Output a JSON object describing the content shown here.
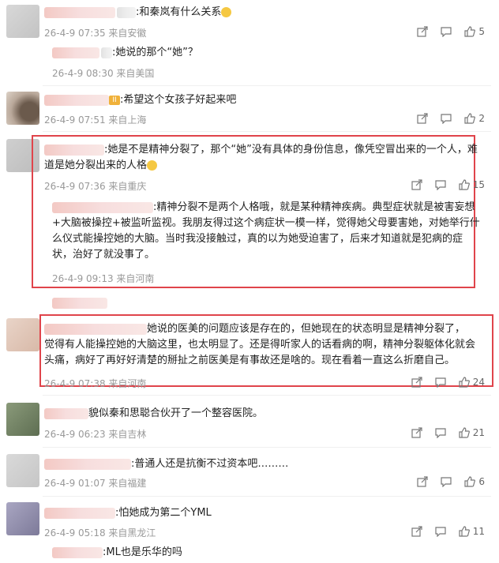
{
  "comments": [
    {
      "text": ":和秦岚有什么关系",
      "meta": "26-4-9 07:35 来自安徽",
      "likes": "5"
    },
    {
      "reply_text": ":她说的那个“她”？",
      "reply_meta": "26-4-9 08:30 来自美国"
    },
    {
      "text": ":希望这个女孩子好起来吧",
      "meta": "26-4-9 07:51 来自上海",
      "likes": "2"
    },
    {
      "text_line1": ":她是不是精神分裂了，那个“她”没有具体的身份信息，像凭空冒出来的一个人，难",
      "text_line2": "道是她分裂出来的人格",
      "meta": "26-4-9 07:36 来自重庆",
      "likes": "15"
    },
    {
      "reply_line1": ":精神分裂不是两个人格哦，就是某种精神疾病。典型症状就是被害妄想",
      "reply_line2": "+大脑被操控+被监听监视。我朋友得过这个病症状一模一样，觉得她父母要害她，对她举行什",
      "reply_line3": "么仪式能操控她的大脑。当时我没接触过，真的以为她受迫害了，后来才知道就是犯病的症",
      "reply_line4": "状，治好了就没事了。",
      "reply_meta": "26-4-9 09:13 来自河南"
    },
    {
      "line1": "她说的医美的问题应该是存在的，但她现在的状态明显是精神分裂了，",
      "line2": "觉得有人能操控她的大脑这里，也太明显了。还是得听家人的话看病的啊，精神分裂躯体化就会",
      "line3": "头痛，病好了再好好清楚的掰扯之前医美是有事故还是啥的。现在看着一直这么折磨自己。",
      "meta": "26-4-9 07:38 来自河南",
      "likes": "24"
    },
    {
      "text": "貌似秦和思聪合伙开了一个整容医院。",
      "meta": "26-4-9 06:23 来自吉林",
      "likes": "21"
    },
    {
      "text": ":普通人还是抗衡不过资本吧………",
      "meta": "26-4-9 01:07 来自福建",
      "likes": "6"
    },
    {
      "text": ":怕她成为第二个YML",
      "meta": "26-4-9 05:18 来自黑龙江",
      "likes": "11"
    },
    {
      "reply_text": ":ML也是乐华的吗"
    }
  ],
  "icons": {
    "share": "share-icon",
    "comment": "comment-icon",
    "like": "thumbs-up-icon"
  },
  "colors": {
    "highlight_border": "#e0444b",
    "username": "#eb7350",
    "meta": "#999999"
  }
}
